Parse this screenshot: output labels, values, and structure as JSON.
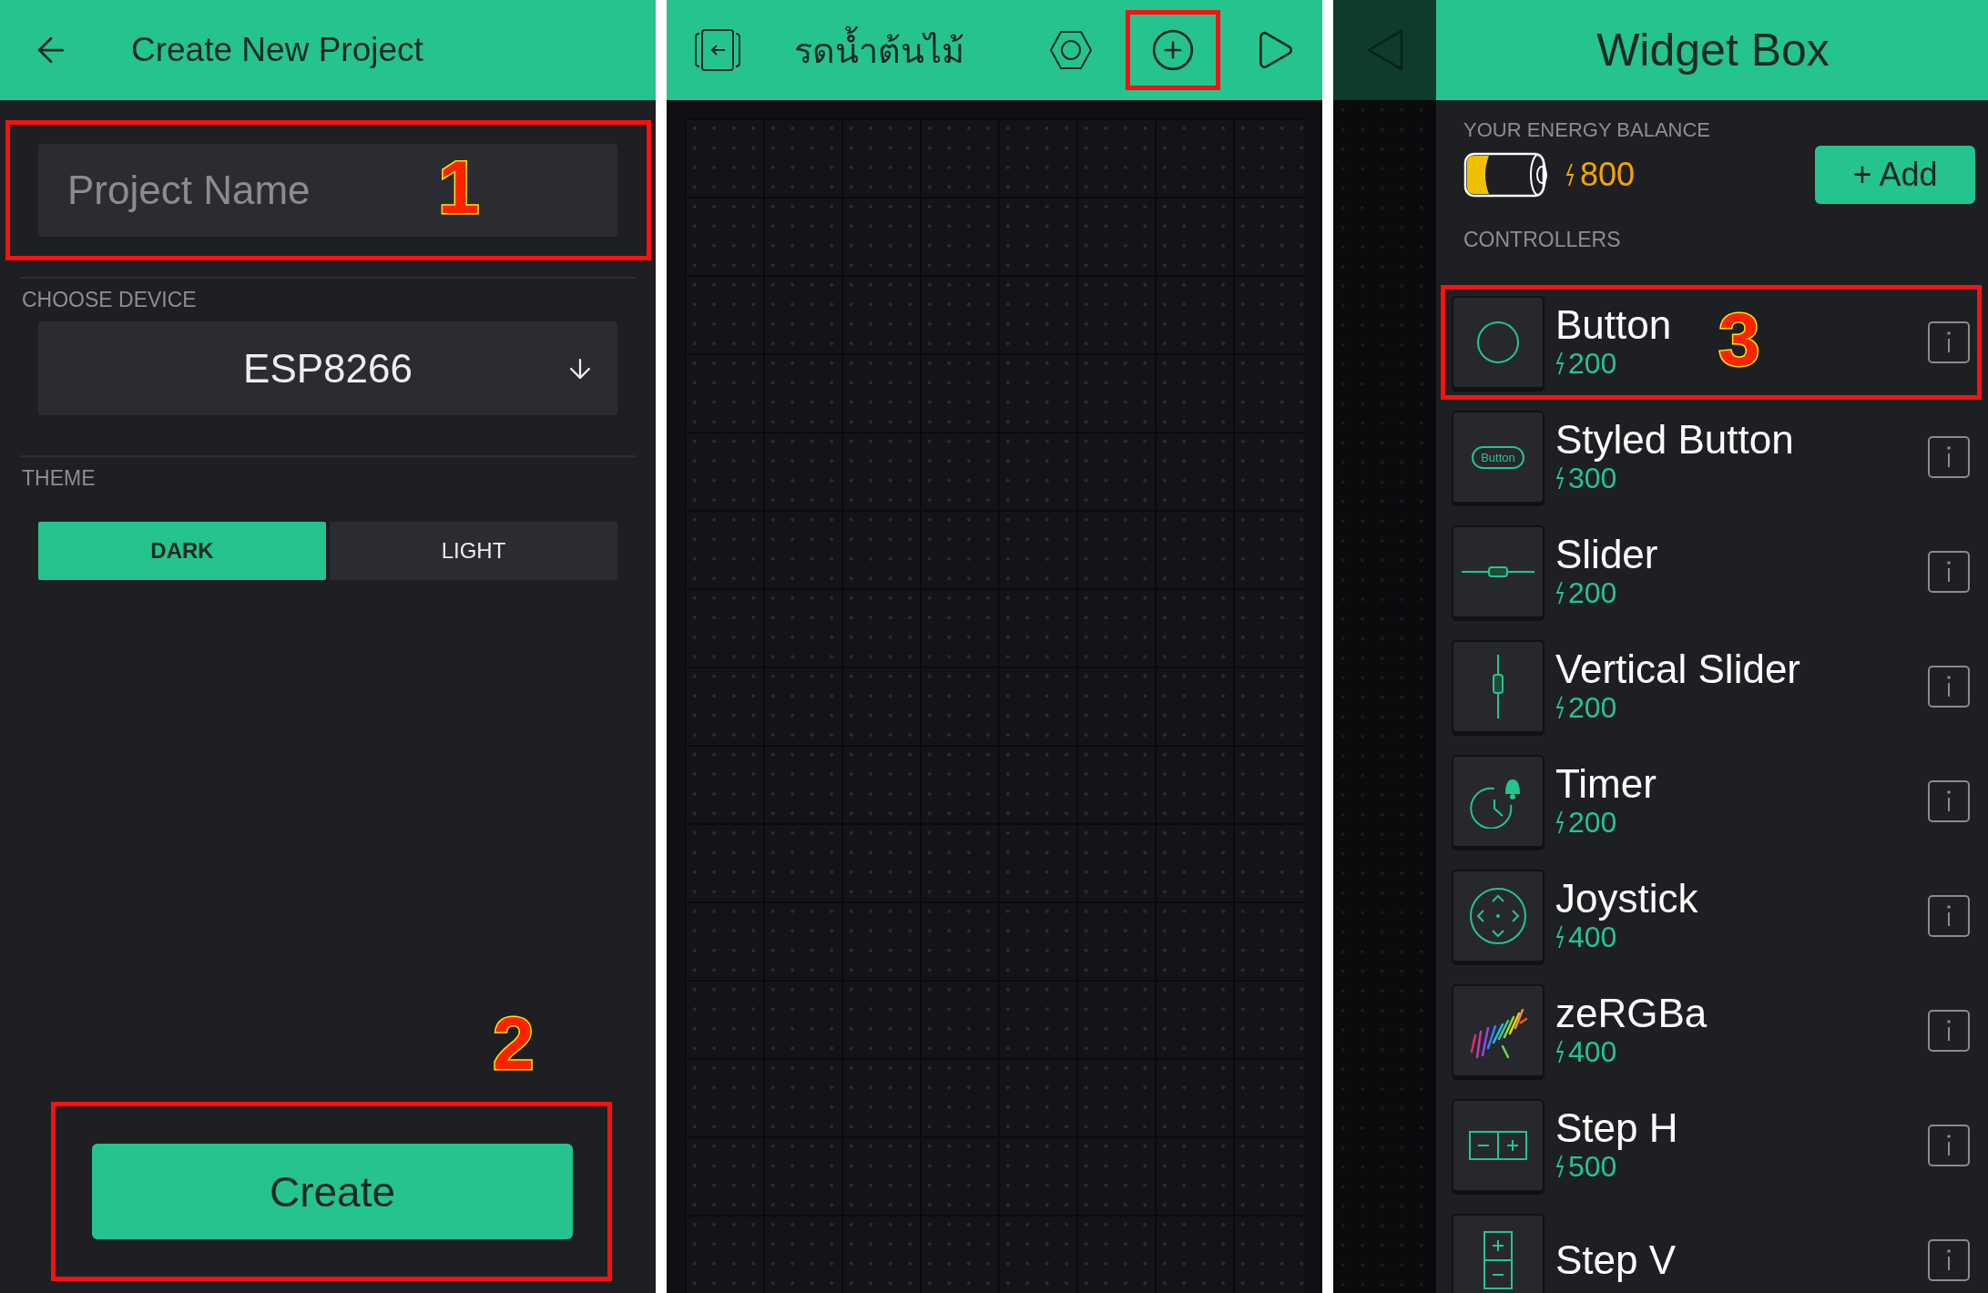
{
  "create_project": {
    "title": "Create New Project",
    "project_name": {
      "placeholder": "Project Name",
      "callout": "1"
    },
    "device_section": {
      "label": "CHOOSE DEVICE",
      "value": "ESP8266"
    },
    "theme_section": {
      "label": "THEME",
      "options": [
        {
          "label": "DARK",
          "selected": true
        },
        {
          "label": "LIGHT",
          "selected": false
        }
      ]
    },
    "create_button": {
      "label": "Create",
      "callout": "2"
    }
  },
  "project_canvas": {
    "title": "รดน้ำต้นไม้",
    "add_highlighted": true
  },
  "widget_box": {
    "title": "Widget Box",
    "energy_label": "YOUR ENERGY BALANCE",
    "energy_amount": "800",
    "add_button": "+ Add",
    "section": "CONTROLLERS",
    "widgets": [
      {
        "kind": "button",
        "name": "Button",
        "cost": "200",
        "callout": "3"
      },
      {
        "kind": "styled_button",
        "name": "Styled Button",
        "cost": "300",
        "icon_text": "Button"
      },
      {
        "kind": "slider",
        "name": "Slider",
        "cost": "200"
      },
      {
        "kind": "vertical_slider",
        "name": "Vertical Slider",
        "cost": "200"
      },
      {
        "kind": "timer",
        "name": "Timer",
        "cost": "200"
      },
      {
        "kind": "joystick",
        "name": "Joystick",
        "cost": "400"
      },
      {
        "kind": "zergba",
        "name": "zeRGBa",
        "cost": "400"
      },
      {
        "kind": "step_h",
        "name": "Step H",
        "cost": "500"
      },
      {
        "kind": "step_v",
        "name": "Step V"
      }
    ]
  }
}
